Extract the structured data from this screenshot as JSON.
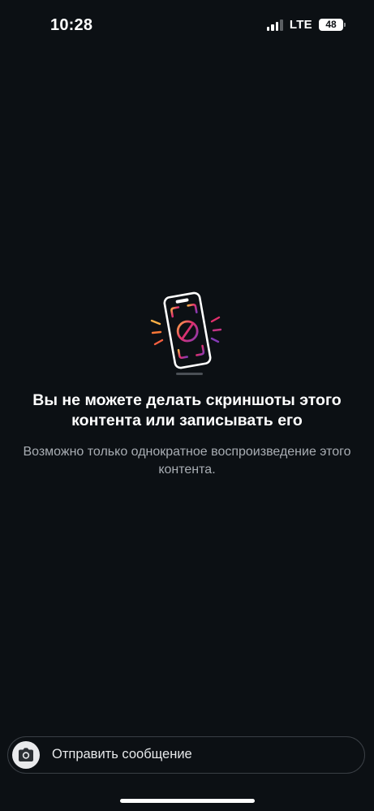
{
  "status_bar": {
    "time": "10:28",
    "network": "LTE",
    "battery": "48"
  },
  "notice": {
    "icon": "no-screenshot-phone-icon",
    "title": "Вы не можете делать скриншоты этого контента или записывать его",
    "body": "Возможно только однократное воспроизведение этого контента."
  },
  "composer": {
    "camera_icon": "camera-icon",
    "placeholder": "Отправить сообщение"
  },
  "colors": {
    "background": "#0c1014",
    "text_primary": "#ffffff",
    "text_secondary": "#a8adb3",
    "gradient_start": "#f77737",
    "gradient_mid": "#e1306c",
    "gradient_end": "#833ab4"
  }
}
